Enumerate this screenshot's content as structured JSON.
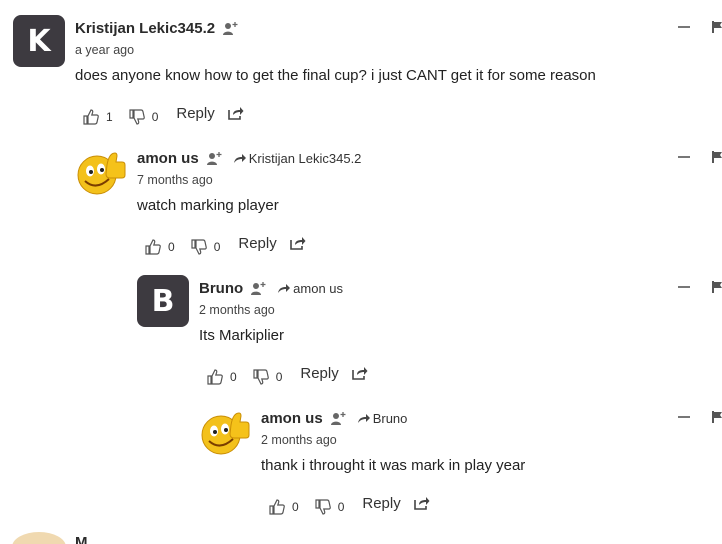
{
  "comments": [
    {
      "author": "Kristijan Lekic345.2",
      "avatar_letter": "K",
      "time": "a year ago",
      "text": "does anyone know how to get the final cup? i just CANT get it for some reason",
      "likes": "1",
      "dislikes": "0",
      "reply_label": "Reply",
      "reply_to": ""
    },
    {
      "author": "amon us",
      "avatar_icon": "thumbs-up-smiley-icon",
      "time": "7 months ago",
      "text": "watch marking player",
      "likes": "0",
      "dislikes": "0",
      "reply_label": "Reply",
      "reply_to": "Kristijan Lekic345.2"
    },
    {
      "author": "Bruno",
      "avatar_letter": "B",
      "time": "2 months ago",
      "text": "Its Markiplier",
      "likes": "0",
      "dislikes": "0",
      "reply_label": "Reply",
      "reply_to": "amon us"
    },
    {
      "author": "amon us",
      "avatar_icon": "thumbs-up-smiley-icon",
      "time": "2 months ago",
      "text": "thank i throught it was mark in play year",
      "likes": "0",
      "dislikes": "0",
      "reply_label": "Reply",
      "reply_to": "Bruno"
    }
  ],
  "next_comment_partial": {
    "author": "M..."
  },
  "colors": {
    "avatar_bg": "#3d3a40",
    "icon_gray": "#555555"
  }
}
